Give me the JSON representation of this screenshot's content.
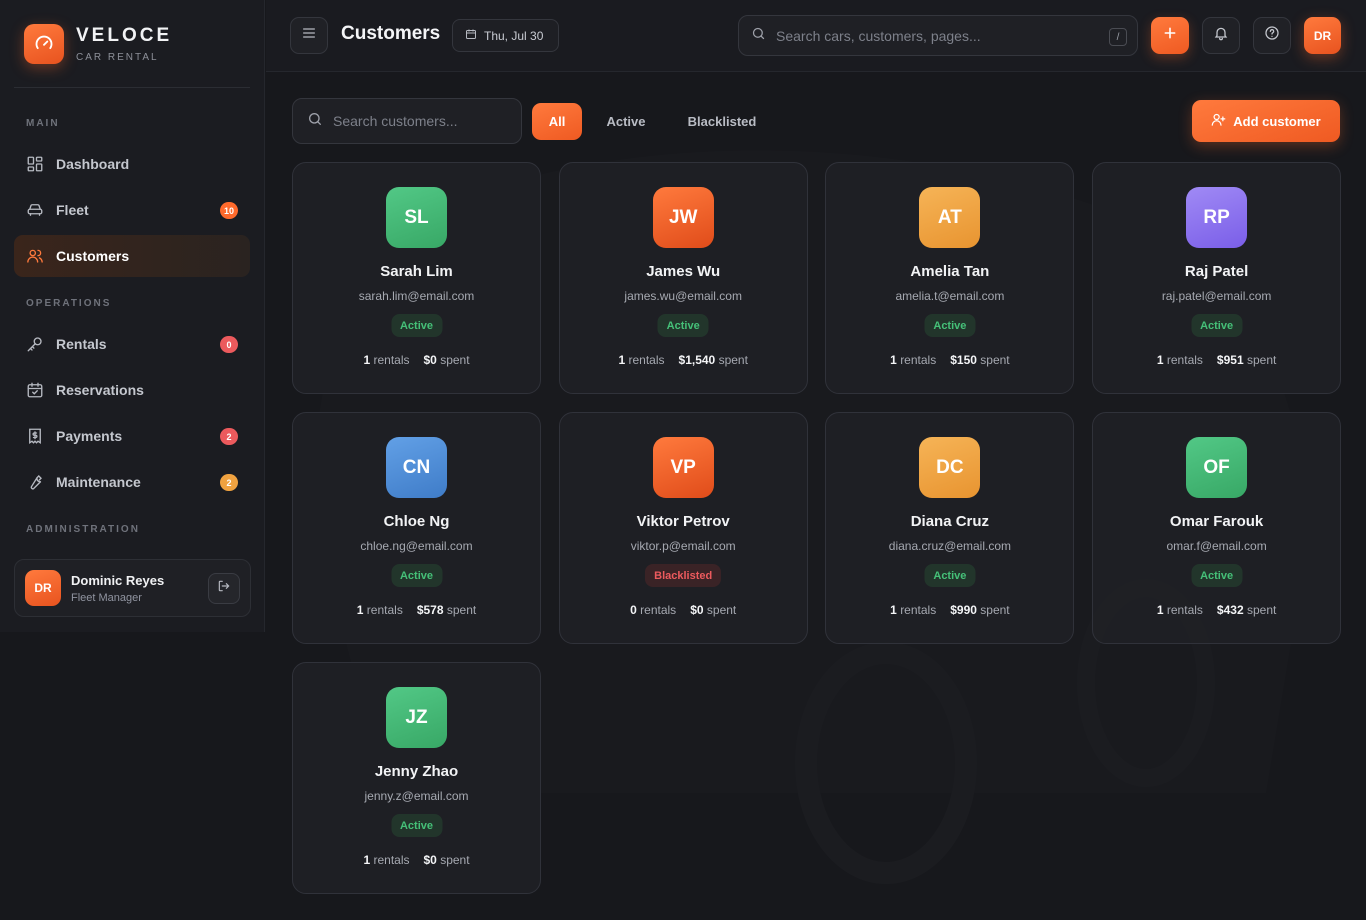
{
  "brand": {
    "name": "VELOCE",
    "subtitle": "CAR RENTAL"
  },
  "sidebar": {
    "sections": {
      "main": "MAIN",
      "operations": "OPERATIONS",
      "administration": "ADMINISTRATION"
    },
    "items": [
      {
        "label": "Dashboard",
        "icon": "dashboard-icon"
      },
      {
        "label": "Fleet",
        "icon": "car-icon",
        "badge": "10"
      },
      {
        "label": "Customers",
        "icon": "users-icon",
        "active": true
      },
      {
        "label": "Rentals",
        "icon": "key-icon",
        "badge": "0"
      },
      {
        "label": "Reservations",
        "icon": "calendar-check-icon"
      },
      {
        "label": "Payments",
        "icon": "receipt-icon",
        "badge": "2"
      },
      {
        "label": "Maintenance",
        "icon": "wrench-icon",
        "badge": "2"
      }
    ],
    "user": {
      "initials": "DR",
      "name": "Dominic Reyes",
      "role": "Fleet Manager"
    }
  },
  "header": {
    "title": "Customers",
    "date": "Thu, Jul 30",
    "search_placeholder": "Search cars, customers, pages...",
    "search_shortcut": "/",
    "avatar_initials": "DR"
  },
  "toolbar": {
    "search_placeholder": "Search customers...",
    "filters": [
      "All",
      "Active",
      "Blacklisted"
    ],
    "add_label": "Add customer"
  },
  "colors": {
    "accent": "#ff6a2c",
    "green": "#45c078",
    "orange": "#ef5a22",
    "amber": "#f0a240",
    "purple": "#8b6ef0",
    "blue": "#4f8fd8",
    "red": "#ec5a5d"
  },
  "customers": [
    {
      "initials": "SL",
      "name": "Sarah Lim",
      "email": "sarah.lim@email.com",
      "status": "Active",
      "rentals": "1",
      "spent": "$0",
      "color": "green"
    },
    {
      "initials": "JW",
      "name": "James Wu",
      "email": "james.wu@email.com",
      "status": "Active",
      "rentals": "1",
      "spent": "$1,540",
      "color": "orange"
    },
    {
      "initials": "AT",
      "name": "Amelia Tan",
      "email": "amelia.t@email.com",
      "status": "Active",
      "rentals": "1",
      "spent": "$150",
      "color": "amber"
    },
    {
      "initials": "RP",
      "name": "Raj Patel",
      "email": "raj.patel@email.com",
      "status": "Active",
      "rentals": "1",
      "spent": "$951",
      "color": "purple"
    },
    {
      "initials": "CN",
      "name": "Chloe Ng",
      "email": "chloe.ng@email.com",
      "status": "Active",
      "rentals": "1",
      "spent": "$578",
      "color": "blue"
    },
    {
      "initials": "VP",
      "name": "Viktor Petrov",
      "email": "viktor.p@email.com",
      "status": "Blacklisted",
      "rentals": "0",
      "spent": "$0",
      "color": "orange"
    },
    {
      "initials": "DC",
      "name": "Diana Cruz",
      "email": "diana.cruz@email.com",
      "status": "Active",
      "rentals": "1",
      "spent": "$990",
      "color": "amber"
    },
    {
      "initials": "OF",
      "name": "Omar Farouk",
      "email": "omar.f@email.com",
      "status": "Active",
      "rentals": "1",
      "spent": "$432",
      "color": "green"
    },
    {
      "initials": "JZ",
      "name": "Jenny Zhao",
      "email": "jenny.z@email.com",
      "status": "Active",
      "rentals": "1",
      "spent": "$0",
      "color": "green"
    }
  ],
  "labels": {
    "rentals": "rentals",
    "spent": "spent"
  }
}
